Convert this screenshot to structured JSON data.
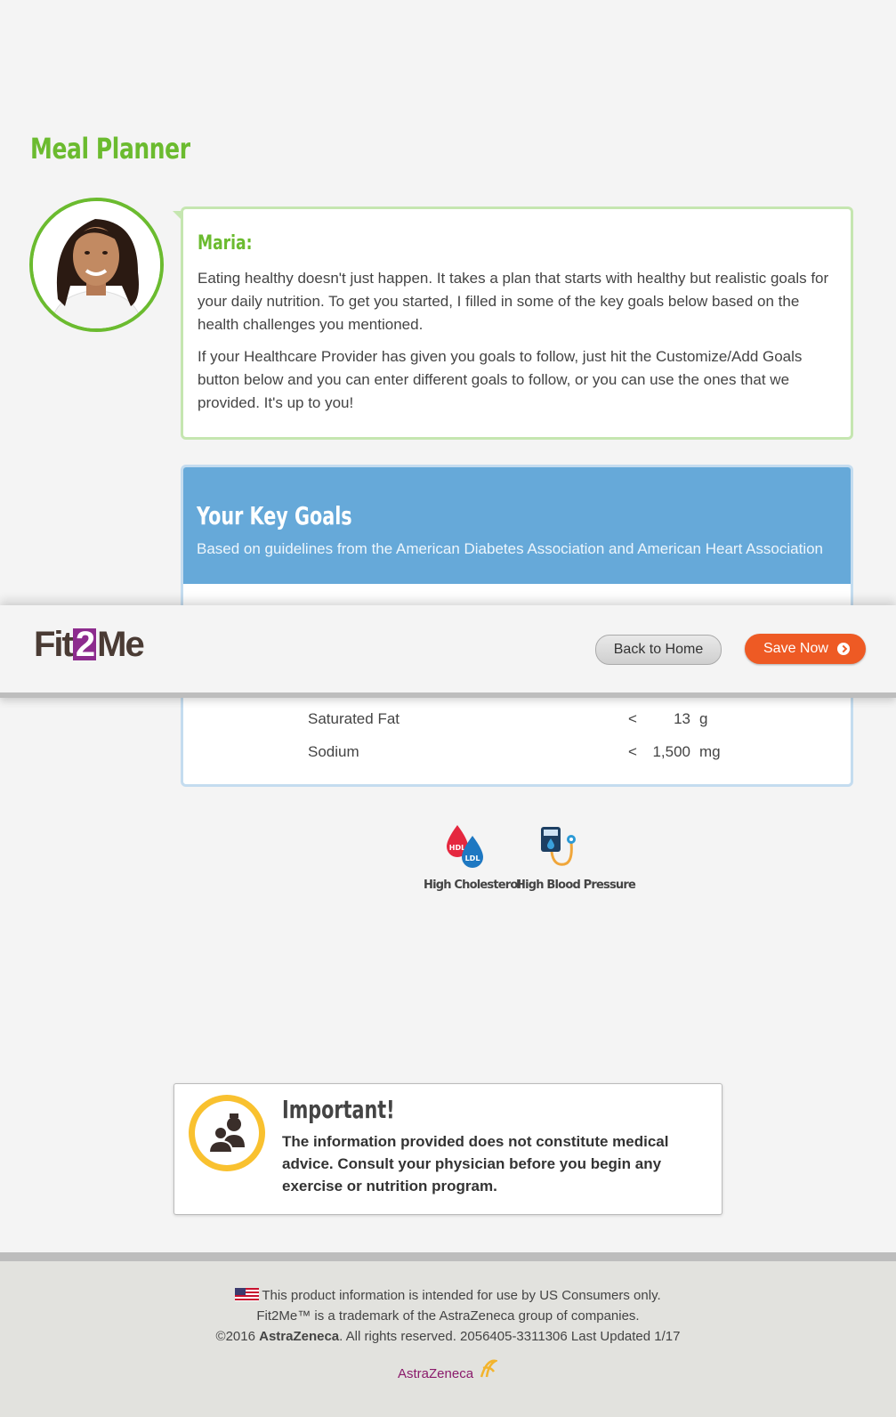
{
  "page_title": "Meal Planner",
  "coach": {
    "name": "Maria:",
    "paragraph1": "Eating healthy doesn't just happen. It takes a plan that starts with healthy but realistic goals for your daily nutrition. To get you started, I filled in some of the key goals below based on the health challenges you mentioned.",
    "paragraph2": "If your Healthcare Provider has given you goals to follow, just hit the Customize/Add Goals button below and you can enter different goals to follow, or you can use the ones that we provided. It's up to you!"
  },
  "goals": {
    "title": "Your Key Goals",
    "subtitle": "Based on guidelines from the American Diabetes Association and American Heart Association",
    "rows": [
      {
        "name": "Saturated Fat",
        "op": "<",
        "value": "13",
        "unit": "g"
      },
      {
        "name": "Sodium",
        "op": "<",
        "value": "1,500",
        "unit": "mg"
      }
    ]
  },
  "toolbar": {
    "logo_part1": "Fit",
    "logo_part2": "2",
    "logo_part3": "Me",
    "back_label": "Back to Home",
    "save_label": "Save Now"
  },
  "conditions": [
    {
      "label": "High Cholesterol",
      "icon": "cholesterol-icon"
    },
    {
      "label": "High Blood Pressure",
      "icon": "blood-pressure-icon"
    }
  ],
  "important": {
    "title": "Important!",
    "text": "The information provided does not constitute medical advice. Consult your physician before you begin any exercise or nutrition program."
  },
  "footer": {
    "line1": "This product information is intended for use by US Consumers only.",
    "line2": "Fit2Me™ is a trademark of the AstraZeneca group of companies.",
    "line3_pre": "©2016 ",
    "line3_brand": "AstraZeneca",
    "line3_post": ". All rights reserved. 2056405-3311306 Last Updated 1/17",
    "logo_text": "AstraZeneca"
  },
  "colors": {
    "green": "#6bbb2f",
    "blue_header": "#66a9d9",
    "orange": "#ee5a24",
    "purple": "#8d2c8e"
  }
}
